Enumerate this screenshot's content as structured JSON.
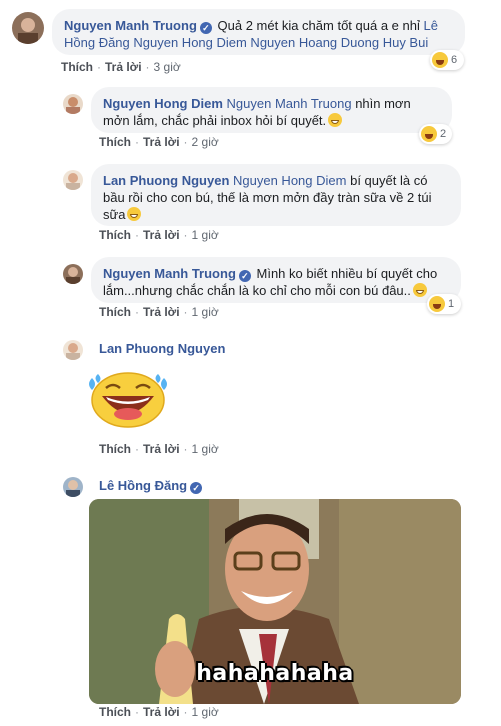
{
  "comments": [
    {
      "author": "Nguyen Manh Truong",
      "verified": true,
      "text": "Quả 2 mét kia chăm tốt quá a e nhỉ",
      "tags_line1": "Lê",
      "tags_line2": "Hồng Đăng Nguyen Hong Diem Nguyen Hoang Duong Huy Bui",
      "like": "Thích",
      "reply": "Trả lời",
      "time": "3 giờ",
      "reaction_count": "6"
    },
    {
      "author": "Nguyen Hong Diem",
      "tag": "Nguyen Manh Truong",
      "text_line1": "nhìn mơn",
      "text_line2": "mởn lắm, chắc phải inbox hỏi bí quyết.",
      "like": "Thích",
      "reply": "Trả lời",
      "time": "2 giờ",
      "reaction_count": "2"
    },
    {
      "author": "Lan Phuong Nguyen",
      "tag": "Nguyen Hong Diem",
      "text_line1": "bí quyết là có",
      "text_line2": "bầu rồi cho con bú, thế là mơn mởn đầy tràn sữa về 2 túi",
      "text_line3": "sữa",
      "like": "Thích",
      "reply": "Trả lời",
      "time": "1 giờ"
    },
    {
      "author": "Nguyen Manh Truong",
      "verified": true,
      "text_line1": "Mình ko biết nhiều bí quyết cho",
      "text_line2": "lắm...nhưng chắc chắn là ko chỉ cho mỗi con bú đâu..",
      "like": "Thích",
      "reply": "Trả lời",
      "time": "1 giờ",
      "reaction_count": "1"
    },
    {
      "author": "Lan Phuong Nguyen",
      "sticker": "laughing-tears-sticker",
      "like": "Thích",
      "reply": "Trả lời",
      "time": "1 giờ"
    },
    {
      "author": "Lê Hồng Đăng",
      "verified": true,
      "gif_caption": "hahahahaha",
      "like": "Thích",
      "reply": "Trả lời",
      "time": "1 giờ"
    }
  ],
  "colors": {
    "link": "#385898",
    "bubble": "#f2f3f5",
    "meta": "#606770",
    "verified": "#4267b2"
  }
}
